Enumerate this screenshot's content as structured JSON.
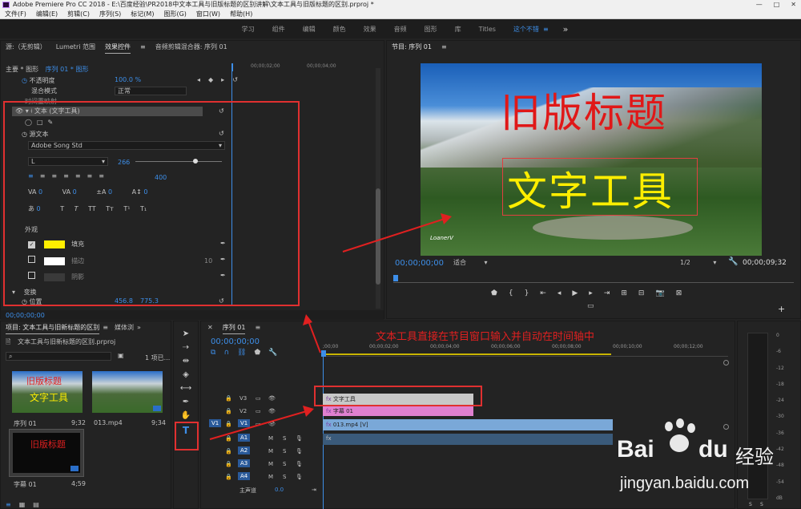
{
  "window_title": "Adobe Premiere Pro CC 2018 - E:\\百度经验\\PR2018中文本工具与旧版标题的区别讲解\\文本工具与旧版标题的区别.prproj *",
  "menu": [
    "文件(F)",
    "编辑(E)",
    "剪辑(C)",
    "序列(S)",
    "标记(M)",
    "图形(G)",
    "窗口(W)",
    "帮助(H)"
  ],
  "workspaces": [
    "学习",
    "组件",
    "编辑",
    "颜色",
    "效果",
    "音频",
    "图形",
    "库",
    "Titles",
    "这个不错"
  ],
  "workspace_more": "»",
  "effects": {
    "tabs": [
      "源:（无剪辑）",
      "Lumetri 范围",
      "效果控件",
      "音频剪辑混合器: 序列 01"
    ],
    "path_master": "主要 * 图形",
    "path_seq": "序列 01 * 图形",
    "opacity_label": "不透明度",
    "opacity_value": "100.0 %",
    "blend_label": "混合模式",
    "blend_value": "正常",
    "time_remap": "时间重映射",
    "text_layer": "文本 (文字工具)",
    "source_text": "源文本",
    "font": "Adobe Song Std",
    "style": "L",
    "size": "266",
    "slider_value": "400",
    "tracking": [
      "0",
      "0",
      "0",
      "0"
    ],
    "leading": "0",
    "styles": [
      "T",
      "T",
      "TT",
      "Tт",
      "T¹",
      "T₁"
    ],
    "appearance": "外观",
    "fill": "填充",
    "stroke": "描边",
    "stroke_value": "10",
    "shadow": "阴影",
    "transform": "变换",
    "position_label": "位置",
    "position_x": "456.8",
    "position_y": "775.3",
    "timecode": "00;00;00;00",
    "fill_color": "#ffee00"
  },
  "program": {
    "title": "节目: 序列 01",
    "old_title": "旧版标题",
    "text_tool": "文字工具",
    "watermark": "LoanerV",
    "timecode": "00;00;00;00",
    "fit": "适合",
    "resolution": "1/2",
    "duration": "00;00;09;32"
  },
  "project": {
    "tab": "项目: 文本工具与旧新标题的区别",
    "tab2": "媒体浏",
    "file": "文本工具与旧新标题的区别.prproj",
    "count": "1 项已...",
    "items": [
      {
        "name": "序列 01",
        "dur": "9;32"
      },
      {
        "name": "013.mp4",
        "dur": "9;34"
      },
      {
        "name": "字幕 01",
        "dur": "4;59"
      }
    ],
    "thumb_old": "旧版标题",
    "thumb_text": "文字工具"
  },
  "timeline": {
    "tab": "序列 01",
    "timecode": "00;00;00;00",
    "ruler": [
      ";00;00",
      "00;00;02;00",
      "00;00;04;00",
      "00;00;06;00",
      "00;00;08;00",
      "00;00;10;00",
      "00;00;12;00"
    ],
    "video_tracks": [
      "V3",
      "V2",
      "V1"
    ],
    "audio_tracks": [
      "A1",
      "A2",
      "A3",
      "A4"
    ],
    "v1_src": "V1",
    "a1_src": "A1",
    "master": "主声道",
    "master_value": "0.0",
    "clip_text": "文字工具",
    "clip_title": "字幕 01",
    "clip_video": "013.mp4 [V]",
    "annotation": "文本工具直接在节目窗口输入并自动在时间轴中"
  },
  "watermark": {
    "brand": "Bai",
    "du": "du",
    "jingyan": "经验",
    "url": "jingyan.baidu.com"
  },
  "meter_labels": [
    "0",
    "-6",
    "-12",
    "-18",
    "-24",
    "-30",
    "-36",
    "-42",
    "-48",
    "-54",
    "dB"
  ],
  "meter_sides": [
    "S",
    "S"
  ]
}
